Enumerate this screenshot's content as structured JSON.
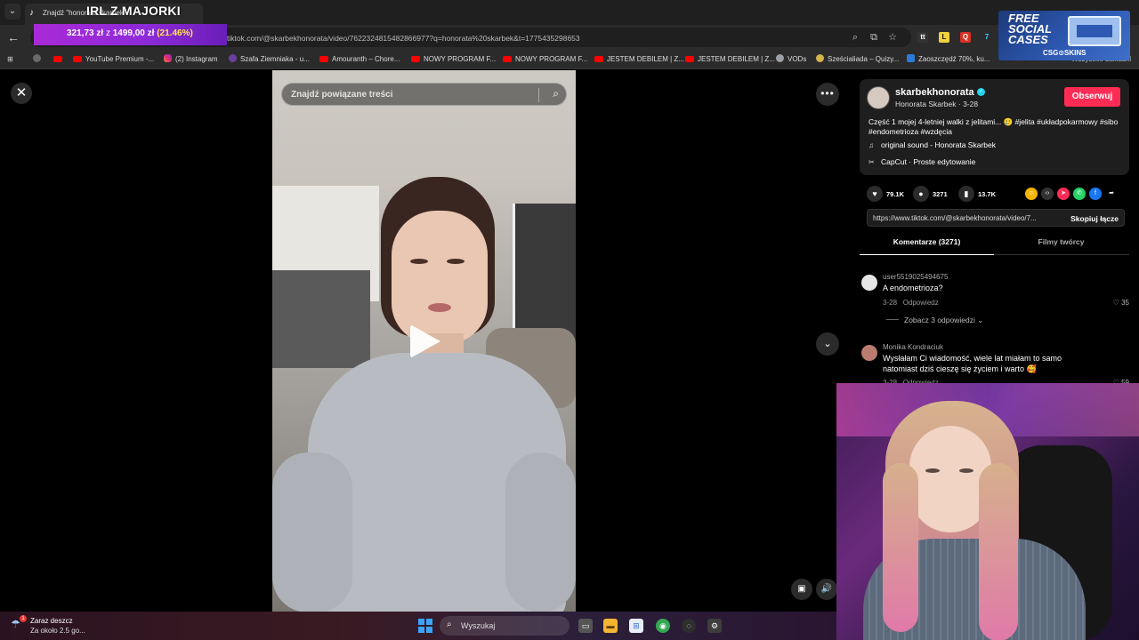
{
  "browser": {
    "tab_title": "Znajdź \"honorata skarbek\"",
    "url": "tiktok.com/@skarbekhonorata/video/7622324815482866977?q=honorata%20skarbek&t=1775435298653",
    "bookmarks": [
      "YouTube Premium -...",
      "(2) Instagram",
      "Szafa Ziemniaka - u...",
      "Amouranth – Chore...",
      "NOWY PROGRAM F...",
      "NOWY PROGRAM F...",
      "JESTEM DEBILEM | Z...",
      "JESTEM DEBILEM | Z...",
      "VODs",
      "Sześcialiada – Quizy...",
      "Zaoszczędź 70%, ku..."
    ],
    "all_bookmarks": "Wszystkie zakładki"
  },
  "overlay": {
    "stream_title": "IRL Z MAJORKI",
    "price_current": "321,73 zł",
    "price_of": "z",
    "price_goal": "1499,00 zł",
    "price_pct": "(21.46%)",
    "progress_fraction": 0.2146
  },
  "ad": {
    "line1": "FREE",
    "line2": "SOCIAL",
    "line3": "CASES",
    "brand": "CSG⊙SKINS"
  },
  "video": {
    "search_placeholder": "Znajdź powiązane treści"
  },
  "author": {
    "username": "skarbekhonorata",
    "nick_date": "Honorata Skarbek · 3-28",
    "follow": "Obserwuj",
    "description": "Część 1 mojej 4-letniej walki z jelitami... 🥲 #jelita #układpokarmowy #sibo #endometrioza #wzdęcia",
    "sound": "original sound - Honorata Skarbek",
    "capcut": "CapCut · Proste edytowanie"
  },
  "stats": {
    "likes": "79.1K",
    "comments": "3271",
    "saves": "13.7K"
  },
  "link": {
    "url": "https://www.tiktok.com/@skarbekhonorata/video/7...",
    "copy": "Skopiuj łącze"
  },
  "tabs": {
    "comments": "Komentarze (3271)",
    "creator": "Filmy twórcy"
  },
  "comments": [
    {
      "user": "user5519025494675",
      "text": "A endometrioza?",
      "date": "3-28",
      "reply": "Odpowiedz",
      "likes": "35",
      "more_replies": "Zobacz 3 odpowiedzi"
    },
    {
      "user": "Monika Kondraciuk",
      "text": "Wysłałam Ci wiadomość, wiele lat miałam to samo natomiast dziś cieszę się życiem i warto 🥰",
      "date": "3-28",
      "reply": "Odpowiedz",
      "likes": "59"
    }
  ],
  "taskbar": {
    "weather_title": "Zaraz deszcz",
    "weather_sub": "Za około 2.5 go...",
    "weather_badge": "1",
    "search_placeholder": "Wyszukaj"
  }
}
